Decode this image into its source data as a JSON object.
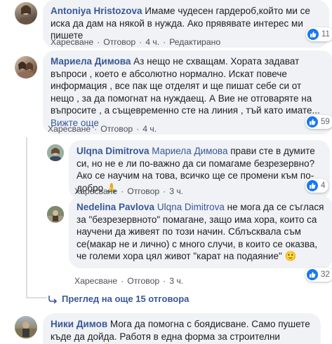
{
  "comments": [
    {
      "author": "Antoniya Hristozova",
      "text": " Имаме чудесен гардероб,който ми се иска да дам на някой в нужда. Ако прявявате интерес ми пишете",
      "actions": {
        "like": "Харесване",
        "reply": "Отговор",
        "time": "4 ч.",
        "edited": "Редактирано"
      },
      "reactions": "11"
    },
    {
      "author": "Мариела Димова",
      "text": " Аз нещо не схващам. Хората задават въпроси , което е абсолютно нормално. Искат повече информация , все пак ще отделят и ще пишат себе си от нещо , за да помогнат на нуждаещ. А Вие не отговаряте на въпросите , а същевременно сте на линия , тъй като имате...",
      "see_more": "Вижте още",
      "actions": {
        "like": "Харесване",
        "reply": "Отговор",
        "time": "4 ч."
      },
      "reactions": "59"
    }
  ],
  "replies": [
    {
      "author": "Ulqna Dimitrova",
      "mention": "Мариела Димова",
      "text": " прави сте в думите си, но не е ли по-важно да си помагаме безрезервно? Ако се научим на това, всичко ще се промени към по-добро 🙏",
      "actions": {
        "like": "Харесване",
        "reply": "Отговор",
        "time": "3 ч."
      },
      "reactions": "4"
    },
    {
      "author": "Nedelina Pavlova",
      "mention": "Ulqna Dimitrova",
      "text": " не мога да се съглася за \"безрезервното\" помагане, защо има хора, които са научени да живеят по този начин. Сблъсквала съм се(макар не и лично) с много случи, в които се оказва, че големи хора цял живот \"карат на подаяние\" 🙂",
      "actions": {
        "like": "Харесване",
        "reply": "Отговор",
        "time": "3 ч."
      },
      "reactions": "32"
    }
  ],
  "more_replies": "Преглед на още 15 отговора",
  "last_comment": {
    "author": "Ники Димов",
    "text": " Мога да помогна с боядисване. Само пушете къде да дойда. Работя в една форма за строителни материали 🙂"
  },
  "colors": {
    "link": "#385898",
    "bubble": "#f0f2f5",
    "like": "#1877f2"
  }
}
